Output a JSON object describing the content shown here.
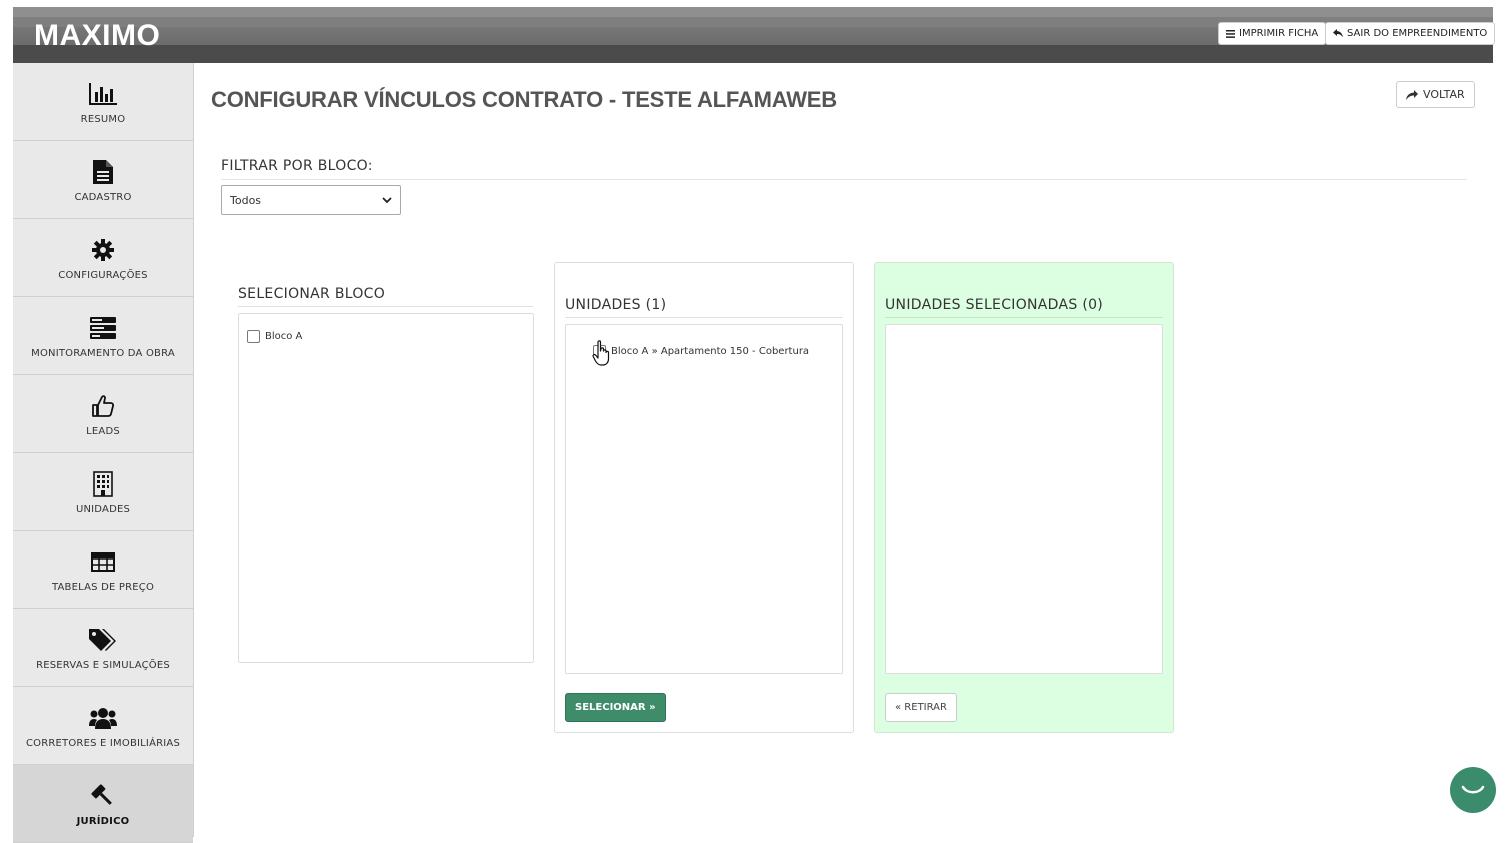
{
  "app": {
    "logo": "MAXIMO",
    "print_button": "IMPRIMIR FICHA",
    "exit_button": "SAIR DO EMPREENDIMENTO"
  },
  "sidebar": {
    "items": [
      {
        "label": "RESUMO",
        "icon": "bar-chart-icon"
      },
      {
        "label": "CADASTRO",
        "icon": "document-icon"
      },
      {
        "label": "CONFIGURAÇÕES",
        "icon": "gear-icon"
      },
      {
        "label": "MONITORAMENTO DA OBRA",
        "icon": "server-stack-icon"
      },
      {
        "label": "LEADS",
        "icon": "thumbs-up-icon"
      },
      {
        "label": "UNIDADES",
        "icon": "building-icon"
      },
      {
        "label": "TABELAS DE PREÇO",
        "icon": "table-icon"
      },
      {
        "label": "RESERVAS E SIMULAÇÕES",
        "icon": "tags-icon"
      },
      {
        "label": "CORRETORES E IMOBILIÁRIAS",
        "icon": "users-icon"
      },
      {
        "label": "JURÍDICO",
        "icon": "gavel-icon",
        "active": true
      }
    ]
  },
  "page": {
    "title": "CONFIGURAR VÍNCULOS CONTRATO - TESTE ALFAMAWEB",
    "back_button": "VOLTAR",
    "filter_label": "FILTRAR POR BLOCO:",
    "filter_value": "Todos"
  },
  "blocks_panel": {
    "title": "SELECIONAR BLOCO",
    "items": [
      {
        "label": "Bloco A",
        "checked": false
      }
    ]
  },
  "units_panel": {
    "title": "UNIDADES (1)",
    "items": [
      {
        "label": "Bloco A » Apartamento 150 - Cobertura",
        "checked": false
      }
    ],
    "select_button": "SELECIONAR »"
  },
  "selected_panel": {
    "title": "UNIDADES SELECIONADAS (0)",
    "items": [],
    "remove_button": "« RETIRAR"
  },
  "colors": {
    "accent_green": "#3f8c6a",
    "selected_panel_bg": "#dbffe0",
    "sidebar_bg": "#e9e9e9",
    "sidebar_active_bg": "#d6d6d6"
  }
}
